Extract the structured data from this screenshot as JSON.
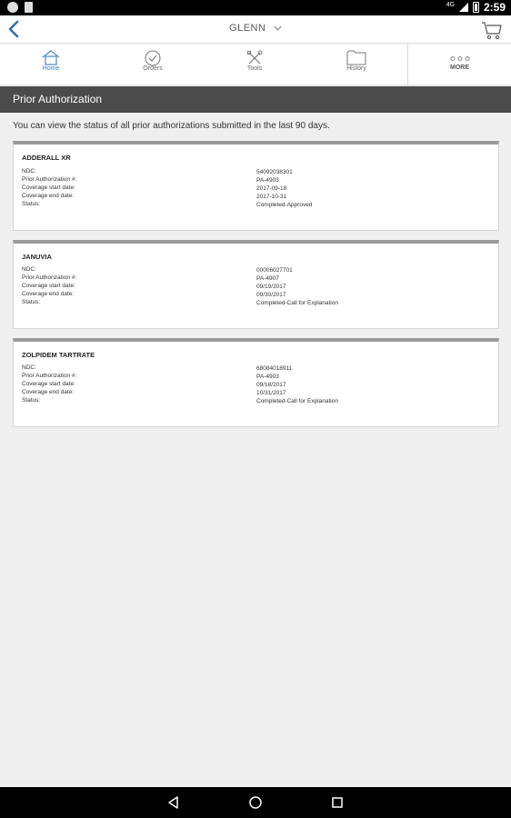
{
  "status_bar": {
    "network": "4G",
    "time": "2:59"
  },
  "header": {
    "user_name": "GLENN"
  },
  "tabs": [
    {
      "label": "Home"
    },
    {
      "label": "Orders"
    },
    {
      "label": "Tools"
    },
    {
      "label": "History"
    },
    {
      "label": "MORE"
    }
  ],
  "page": {
    "title": "Prior Authorization",
    "intro": "You can view the status of all prior authorizations submitted in the last 90 days."
  },
  "field_labels": {
    "ndc": "NDC:",
    "pa_number": "Prior Authorization #:",
    "start": "Coverage start date:",
    "end": "Coverage end date:",
    "status": "Status:"
  },
  "authorizations": [
    {
      "drug": "ADDERALL XR",
      "ndc": "54092038301",
      "pa_number": "PA-4903",
      "start": "2017-09-18",
      "end": "2017-10-31",
      "status": "Completed-Approved"
    },
    {
      "drug": "JANUVIA",
      "ndc": "00006027701",
      "pa_number": "PA-4907",
      "start": "09/19/2017",
      "end": "09/30/2017",
      "status": "Completed-Call for Explanation"
    },
    {
      "drug": "ZOLPIDEM TARTRATE",
      "ndc": "68084018911",
      "pa_number": "PA-4903",
      "start": "09/18/2017",
      "end": "10/31/2017",
      "status": "Completed-Call for Explanation"
    }
  ],
  "icons": {
    "back": "chevron-left-icon",
    "cart": "cart-icon",
    "home": "home-icon",
    "orders": "check-circle-icon",
    "tools": "wrench-screwdriver-icon",
    "history": "folder-icon",
    "more": "dots-icon"
  },
  "colors": {
    "accent": "#3a7bbd",
    "title_bar": "#4b4b4b",
    "background": "#efefef"
  }
}
